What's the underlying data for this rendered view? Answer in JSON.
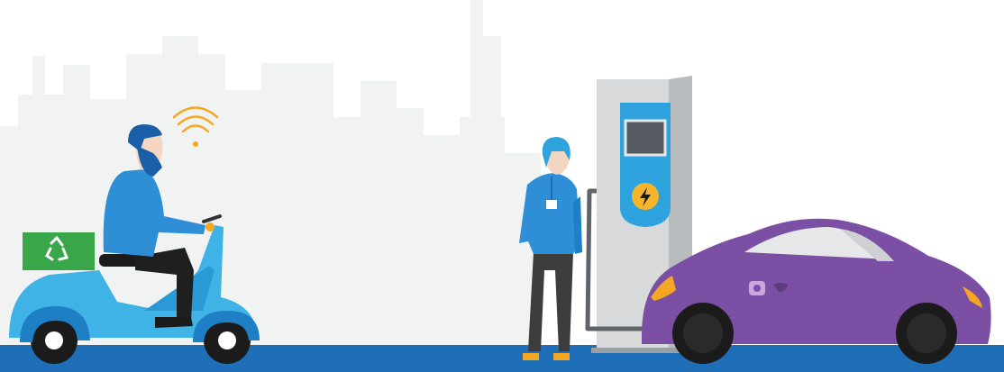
{
  "scene": {
    "colors": {
      "background": "#ffffff",
      "skyline": "#f1f3f3",
      "ground": "#1e6fb8",
      "scooter_body": "#3fb2e6",
      "scooter_dark": "#1f7fc4",
      "rider_shirt": "#2e8fd6",
      "rider_hair": "#1b5ea8",
      "recycle_box": "#3aa64a",
      "wifi_signal": "#f5a623",
      "charger_body": "#d7d9da",
      "charger_side": "#b8bcbf",
      "charger_panel": "#2ea3de",
      "bolt_badge": "#f7b52c",
      "car_body": "#7b4fa3",
      "car_window": "#e6e7e9",
      "car_headlight": "#f5a623",
      "staff_shirt": "#2e8fd6",
      "staff_pants": "#3d3d3d"
    },
    "icons": [
      "wifi-signal-icon",
      "recycle-icon",
      "lightning-bolt-icon",
      "charging-plug-icon"
    ]
  }
}
